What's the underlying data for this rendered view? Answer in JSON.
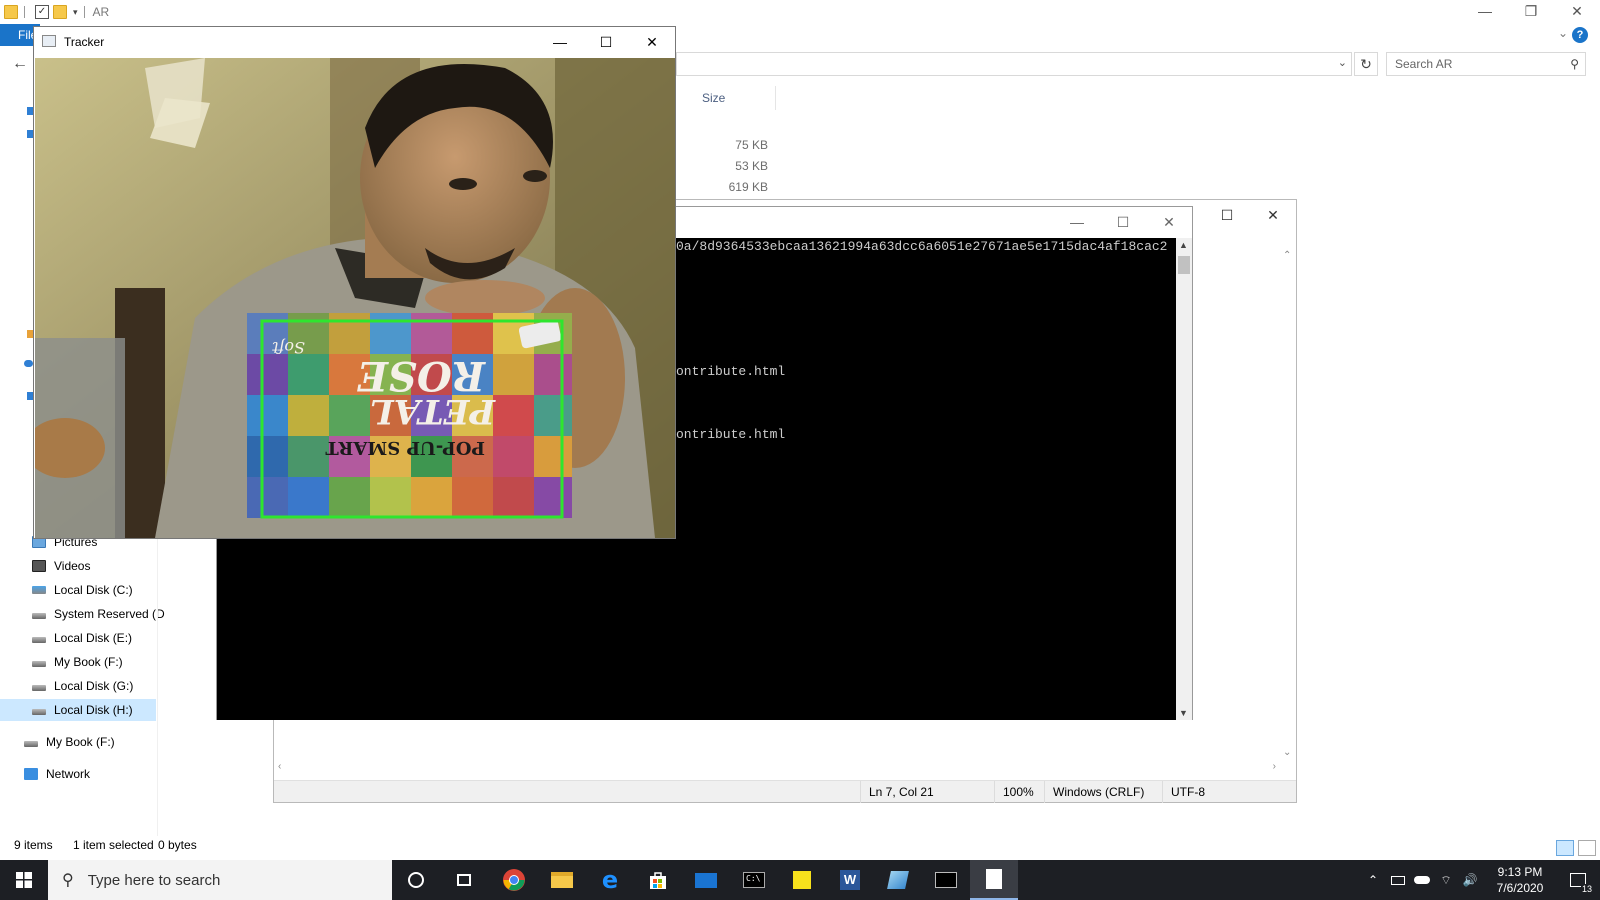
{
  "explorer": {
    "folder_title": "AR",
    "ribbon_file_label": "File",
    "search_placeholder": "Search AR",
    "col_size_header": "Size",
    "sizes": [
      "75 KB",
      "53 KB",
      "619 KB"
    ],
    "nav_items": [
      {
        "label": "Pictures"
      },
      {
        "label": "Videos"
      },
      {
        "label": "Local Disk (C:)"
      },
      {
        "label": "System Reserved (D"
      },
      {
        "label": "Local Disk (E:)"
      },
      {
        "label": "My Book (F:)"
      },
      {
        "label": "Local Disk (G:)"
      },
      {
        "label": "Local Disk (H:)"
      }
    ],
    "nav_mybook": "My Book (F:)",
    "nav_network": "Network",
    "status_items": "9 items",
    "status_selected": "1 item selected",
    "status_bytes": "0 bytes"
  },
  "notepad": {
    "status_position": "Ln 7, Col 21",
    "status_zoom": "100%",
    "status_eol": "Windows (CRLF)",
    "status_encoding": "UTF-8"
  },
  "console": {
    "line1": "0a/8d9364533ebcaa13621994a63dcc6a6051e27671ae5e1715dac4af18cac2",
    "line2": "ontribute.html",
    "line3": "ontribute.html"
  },
  "tracker": {
    "title": "Tracker",
    "box_text_1": "POP-UP SMART",
    "box_text_2": "PETAL",
    "box_text_3": "ROSE",
    "box_text_4": "Soft"
  },
  "taskbar": {
    "search_placeholder": "Type here to search",
    "time": "9:13 PM",
    "date": "7/6/2020",
    "notification_count": "13"
  }
}
